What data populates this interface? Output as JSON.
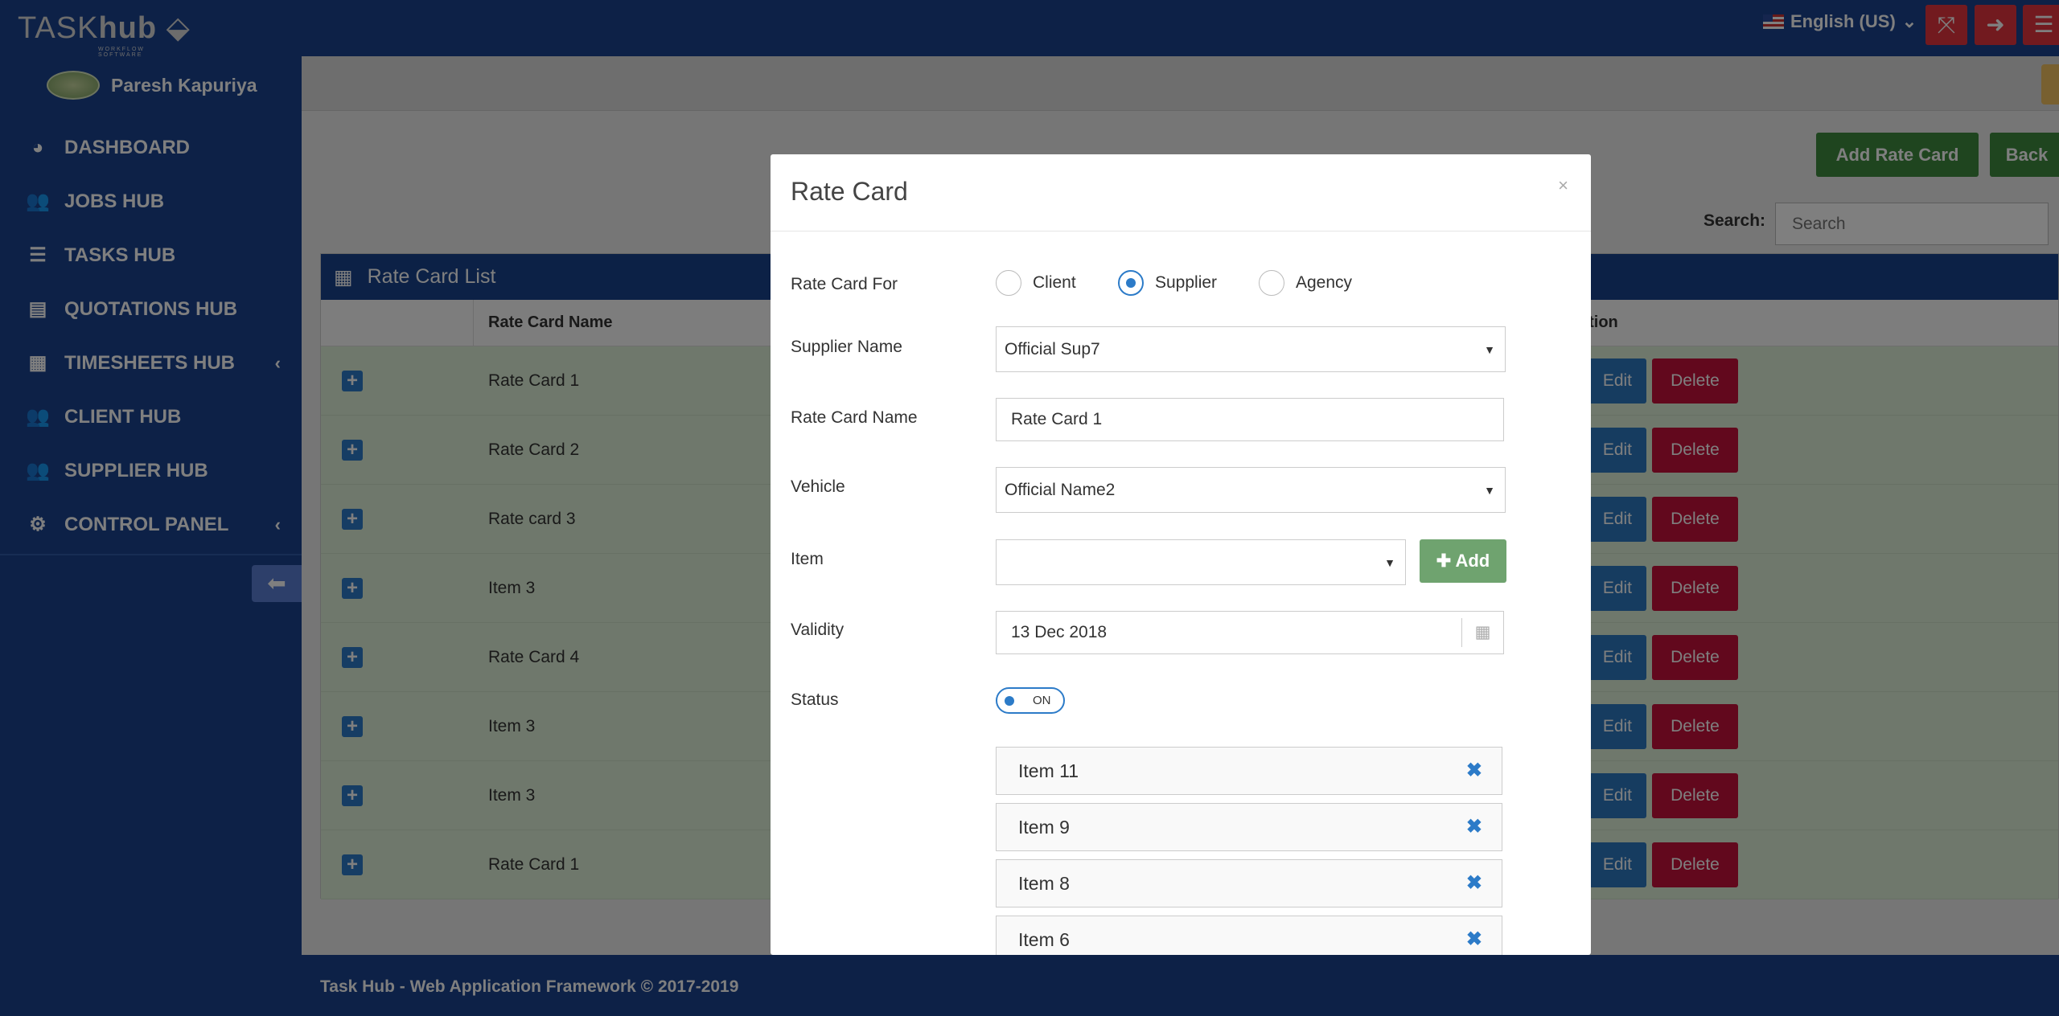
{
  "app": {
    "logo": "TASKhub",
    "logo_tagline": "WORKFLOW SOFTWARE",
    "language": "English (US)"
  },
  "topbar": {
    "icons": [
      "fullscreen-icon",
      "logout-icon",
      "menu-icon"
    ]
  },
  "sidebar": {
    "user": "Paresh Kapuriya",
    "items": [
      {
        "label": "DASHBOARD",
        "icon": "dashboard-icon"
      },
      {
        "label": "JOBS HUB",
        "icon": "users-icon"
      },
      {
        "label": "TASKS HUB",
        "icon": "server-icon"
      },
      {
        "label": "QUOTATIONS HUB",
        "icon": "list-icon"
      },
      {
        "label": "TIMESHEETS HUB",
        "icon": "calendar-icon",
        "has_submenu": true
      },
      {
        "label": "CLIENT HUB",
        "icon": "users-icon"
      },
      {
        "label": "SUPPLIER HUB",
        "icon": "users-icon"
      },
      {
        "label": "CONTROL PANEL",
        "icon": "cogs-icon",
        "has_submenu": true
      }
    ]
  },
  "toolbar": {
    "add_label": "Add Rate Card",
    "back_label": "Back",
    "search_label": "Search:",
    "search_placeholder": "Search"
  },
  "table": {
    "title": "Rate Card List",
    "columns": [
      "",
      "Rate Card Name",
      "ction"
    ],
    "rows": [
      "Rate Card 1",
      "Rate Card 2",
      "Rate card 3",
      "Item 3",
      "Rate Card 4",
      "Item 3",
      "Item 3",
      "Rate Card 1"
    ],
    "edit_label": "Edit",
    "delete_label": "Delete"
  },
  "footer": "Task Hub - Web Application Framework © 2017-2019",
  "modal": {
    "title": "Rate Card",
    "close": "×",
    "rate_card_for": {
      "label": "Rate Card For",
      "options": [
        "Client",
        "Supplier",
        "Agency"
      ],
      "selected": "Supplier"
    },
    "supplier": {
      "label": "Supplier Name",
      "value": "Official Sup7"
    },
    "name": {
      "label": "Rate Card Name",
      "value": "Rate Card 1"
    },
    "vehicle": {
      "label": "Vehicle",
      "value": "Official Name2"
    },
    "item": {
      "label": "Item",
      "value": "",
      "add_label": "Add"
    },
    "validity": {
      "label": "Validity",
      "value": "13 Dec 2018"
    },
    "status": {
      "label": "Status",
      "value": "ON"
    },
    "items": [
      "Item 11",
      "Item 9",
      "Item 8",
      "Item 6"
    ]
  },
  "colors": {
    "navy": "#1b438f",
    "danger": "#c4113a",
    "primary": "#2c78c0",
    "success": "#3f8a3f",
    "row": "#dff0d8"
  }
}
